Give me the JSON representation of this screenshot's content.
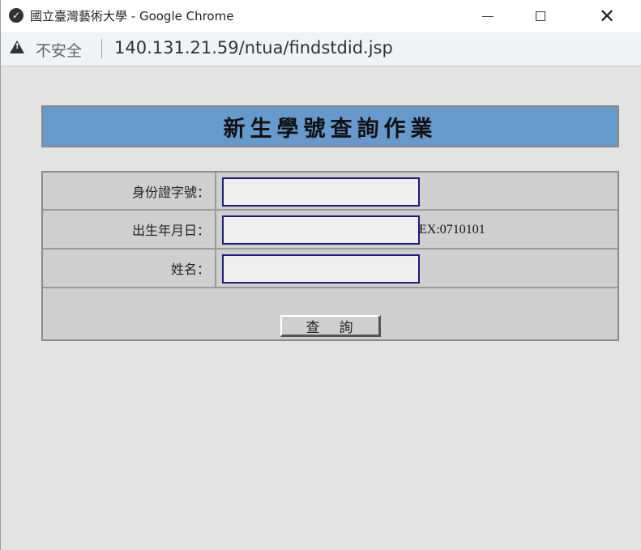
{
  "window": {
    "title": "國立臺灣藝術大學 - Google Chrome",
    "icon": "chrome-shield-icon"
  },
  "addressbar": {
    "security_label": "不安全",
    "url": "140.131.21.59/ntua/findstdid.jsp"
  },
  "page": {
    "banner_title": "新生學號查詢作業",
    "form": {
      "id_label": "身份證字號：",
      "birthday_label": "出生年月日：",
      "birthday_hint": "EX:0710101",
      "name_label": "姓名：",
      "id_value": "",
      "birthday_value": "",
      "name_value": "",
      "submit_label": "查詢"
    }
  }
}
